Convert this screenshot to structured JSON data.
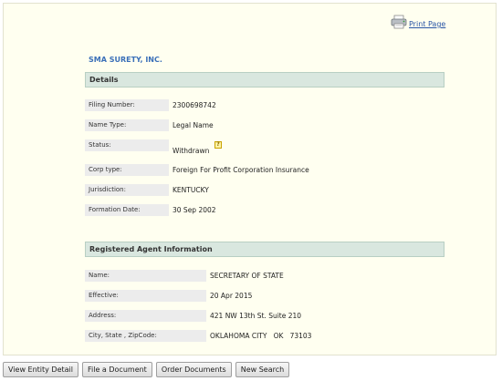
{
  "print_label": "Print Page",
  "entity_name": "SMA SURETY, INC.",
  "details": {
    "header": "Details",
    "rows": [
      {
        "label": "Filing Number:",
        "value": "2300698742"
      },
      {
        "label": "Name Type:",
        "value": "Legal Name"
      },
      {
        "label": "Status:",
        "value": "Withdrawn"
      },
      {
        "label": "Corp type:",
        "value": "Foreign For Profit Corporation Insurance"
      },
      {
        "label": "Jurisdiction:",
        "value": "KENTUCKY"
      },
      {
        "label": "Formation Date:",
        "value": "30 Sep 2002"
      }
    ]
  },
  "agent": {
    "header": "Registered Agent Information",
    "rows": [
      {
        "label": "Name:",
        "value": "SECRETARY OF STATE"
      },
      {
        "label": "Effective:",
        "value": "20 Apr 2015"
      },
      {
        "label": "Address:",
        "value": "421 NW 13th St. Suite 210"
      },
      {
        "label": "City, State , ZipCode:",
        "value": "OKLAHOMA CITY   OK   73103"
      }
    ]
  },
  "buttons": {
    "view_entity": "View Entity Detail",
    "file_document": "File a Document",
    "order_documents": "Order Documents",
    "new_search": "New Search"
  },
  "icons": {
    "print": "printer-icon",
    "status_help": "help-icon"
  }
}
